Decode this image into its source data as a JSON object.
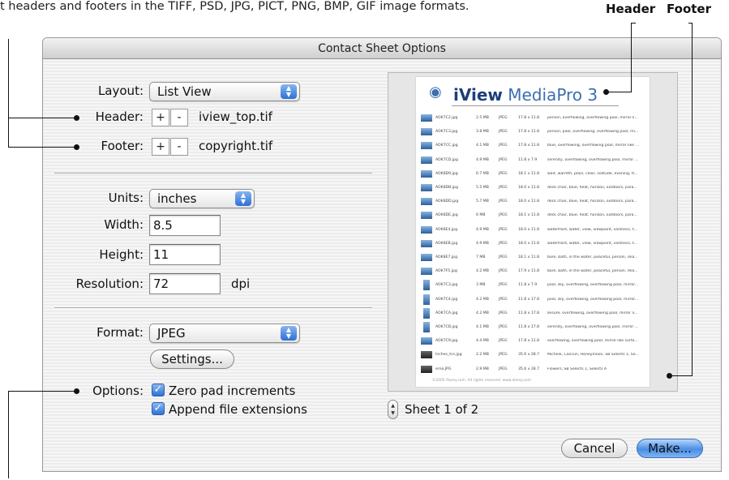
{
  "caption": "t headers and footers in the TIFF, PSD, JPG, PICT, PNG, BMP, GIF image formats.",
  "callouts": {
    "header": "Header",
    "footer": "Footer"
  },
  "window": {
    "title": "Contact Sheet Options"
  },
  "layout": {
    "label": "Layout:",
    "value": "List View"
  },
  "header_row": {
    "label": "Header:",
    "plus": "+",
    "minus": "-",
    "file": "iview_top.tif"
  },
  "footer_row": {
    "label": "Footer:",
    "plus": "+",
    "minus": "-",
    "file": "copyright.tif"
  },
  "units": {
    "label": "Units:",
    "value": "inches"
  },
  "width": {
    "label": "Width:",
    "value": "8.5"
  },
  "height": {
    "label": "Height:",
    "value": "11"
  },
  "resolution": {
    "label": "Resolution:",
    "value": "72",
    "unit": "dpi"
  },
  "format": {
    "label": "Format:",
    "value": "JPEG",
    "settings_label": "Settings..."
  },
  "options": {
    "label": "Options:",
    "items": [
      {
        "label": "Zero pad increments",
        "checked": true
      },
      {
        "label": "Append file extensions",
        "checked": true
      }
    ]
  },
  "preview": {
    "logo_prefix": "iView",
    "logo_rest": " MediaPro 3",
    "rows": [
      {
        "name": "AOK7C2.jpg",
        "size": "2.5 MB",
        "type": "JPEG",
        "dims": "17.8 x 11.8",
        "keywords": "person, overflowing, overflowing pool, mirror li..."
      },
      {
        "name": "AOK7C3.jpg",
        "size": "3.8 MB",
        "type": "JPEG",
        "dims": "17.8 x 11.8",
        "keywords": "person, pool, overflowing, overflowing pool, mi..."
      },
      {
        "name": "AOK7CC.jpg",
        "size": "4.1 MB",
        "type": "JPEG",
        "dims": "17.8 x 11.8",
        "keywords": "blue, overflowing, overflowing pool, mirror like ..."
      },
      {
        "name": "AOK7CD.jpg",
        "size": "4.9 MB",
        "type": "JPEG",
        "dims": "11.8 x 7.9",
        "keywords": "serenity, overflowing, overflowing pool, mirror ..."
      },
      {
        "name": "AOK8D9.jpg",
        "size": "6.7 MB",
        "type": "JPEG",
        "dims": "18.1 x 11.8",
        "keywords": "wait, warmth, plain, clear, solitude, evening, tr..."
      },
      {
        "name": "AOK8DB.jpg",
        "size": "5.5 MB",
        "type": "JPEG",
        "dims": "18.0 x 11.8",
        "keywords": "deck chair, blue, heat, horizon, outdoors, para..."
      },
      {
        "name": "AOK8DD.jpg",
        "size": "5.7 MB",
        "type": "JPEG",
        "dims": "18.0 x 11.8",
        "keywords": "deck chair, blue, heat, horizon, outdoors, para..."
      },
      {
        "name": "AOK8DE.jpg",
        "size": "6 MB",
        "type": "JPEG",
        "dims": "18.1 x 11.8",
        "keywords": "deck chair, blue, heat, horizon, outdoors, para..."
      },
      {
        "name": "AOK8E4.jpg",
        "size": "4.9 MB",
        "type": "JPEG",
        "dims": "18.0 x 11.8",
        "keywords": "waterfront, water, view, viewpoint, vastness, t..."
      },
      {
        "name": "AOK8EB.jpg",
        "size": "4.9 MB",
        "type": "JPEG",
        "dims": "18.0 x 11.8",
        "keywords": "waterfront, water, view, viewpoint, vastness, t..."
      },
      {
        "name": "AOK8E7.jpg",
        "size": "7 MB",
        "type": "JPEG",
        "dims": "18.1 x 11.8",
        "keywords": "bare, bath, in the water, peaceful, person, rela..."
      },
      {
        "name": "AOK7F5.jpg",
        "size": "4.2 MB",
        "type": "JPEG",
        "dims": "17.9 x 11.8",
        "keywords": "bare, bath, in the water, peaceful, person, rela..."
      },
      {
        "name": "AOK7C3.jpg",
        "size": "3 MB",
        "type": "JPEG",
        "dims": "11.8 x 7.9",
        "keywords": "pool, sky, overflowing, overflowing pool, mirror..."
      },
      {
        "name": "AOK7C4.jpg",
        "size": "4.2 MB",
        "type": "JPEG",
        "dims": "11.8 x 17.8",
        "keywords": "pool, sky, overflowing, overflowing pool, mirror..."
      },
      {
        "name": "AOK7CA.jpg",
        "size": "4.2 MB",
        "type": "JPEG",
        "dims": "11.8 x 17.8",
        "keywords": "leisure, overflowing, overflowing pool, mirror li..."
      },
      {
        "name": "AOK7CB.jpg",
        "size": "4.1 MB",
        "type": "JPEG",
        "dims": "11.8 x 17.8",
        "keywords": "serenity, overflowing, overflowing pool, mirror ..."
      },
      {
        "name": "AOK7C9.jpg",
        "size": "4.4 MB",
        "type": "JPEG",
        "dims": "17.8 x 11.8",
        "keywords": "overflowing, overflowing pool, mirror like surfa..."
      },
      {
        "name": "Inches_tcs.jpg",
        "size": "2.2 MB",
        "type": "JPEG",
        "dims": "35.6 x 28.7",
        "keywords": "Michele, Cancun, Honeymoon, SB Selects 1, Se..."
      },
      {
        "name": "erna.JPG",
        "size": "2.9 MB",
        "type": "JPEG",
        "dims": "35.6 x 28.7",
        "keywords": "Flowers, SB Selects 1, Selects A"
      }
    ],
    "footer_text": "©2005 Alamy.com. All rights reserved. www.alamy.com"
  },
  "sheet": {
    "text": "Sheet 1 of 2"
  },
  "buttons": {
    "cancel": "Cancel",
    "make": "Make..."
  },
  "colors": {
    "accent": "#3b7fe0",
    "logo": "#3b6fb0"
  },
  "icons": {
    "popup_arrow": "updown-arrows-icon",
    "logo": "eye-icon",
    "stepper": "stepper-icon"
  }
}
